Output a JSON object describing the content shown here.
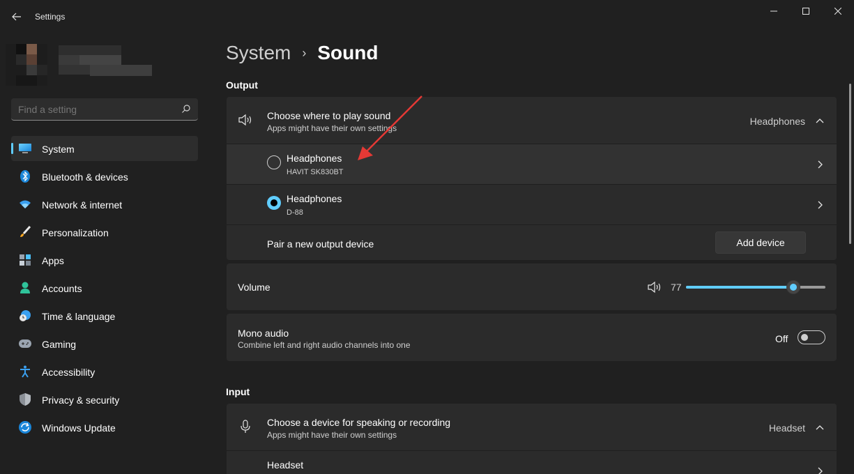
{
  "app": {
    "title": "Settings"
  },
  "colors": {
    "accent": "#60cdff",
    "background": "#202020",
    "card": "#2b2b2b"
  },
  "search": {
    "placeholder": "Find a setting",
    "icon": "search-icon"
  },
  "sidebar": {
    "items": [
      {
        "label": "System",
        "icon": "system-icon",
        "active": true
      },
      {
        "label": "Bluetooth & devices",
        "icon": "bluetooth-icon"
      },
      {
        "label": "Network & internet",
        "icon": "wifi-icon"
      },
      {
        "label": "Personalization",
        "icon": "brush-icon"
      },
      {
        "label": "Apps",
        "icon": "apps-icon"
      },
      {
        "label": "Accounts",
        "icon": "person-icon"
      },
      {
        "label": "Time & language",
        "icon": "clock-globe-icon"
      },
      {
        "label": "Gaming",
        "icon": "gamepad-icon"
      },
      {
        "label": "Accessibility",
        "icon": "accessibility-icon"
      },
      {
        "label": "Privacy & security",
        "icon": "shield-icon"
      },
      {
        "label": "Windows Update",
        "icon": "update-icon"
      }
    ]
  },
  "breadcrumb": {
    "parent": "System",
    "separator": "›",
    "current": "Sound"
  },
  "output": {
    "section_title": "Output",
    "choose": {
      "title": "Choose where to play sound",
      "subtitle": "Apps might have their own settings",
      "value": "Headphones"
    },
    "devices": [
      {
        "name": "Headphones",
        "model": "HAVIT SK830BT",
        "selected": false
      },
      {
        "name": "Headphones",
        "model": "D-88",
        "selected": true
      }
    ],
    "pair": {
      "label": "Pair a new output device",
      "button": "Add device"
    }
  },
  "volume": {
    "label": "Volume",
    "value": "77",
    "level": 0.77
  },
  "mono": {
    "title": "Mono audio",
    "subtitle": "Combine left and right audio channels into one",
    "state": "Off"
  },
  "input": {
    "section_title": "Input",
    "choose": {
      "title": "Choose a device for speaking or recording",
      "subtitle": "Apps might have their own settings",
      "value": "Headset"
    },
    "devices": [
      {
        "name": "Headset"
      }
    ]
  }
}
